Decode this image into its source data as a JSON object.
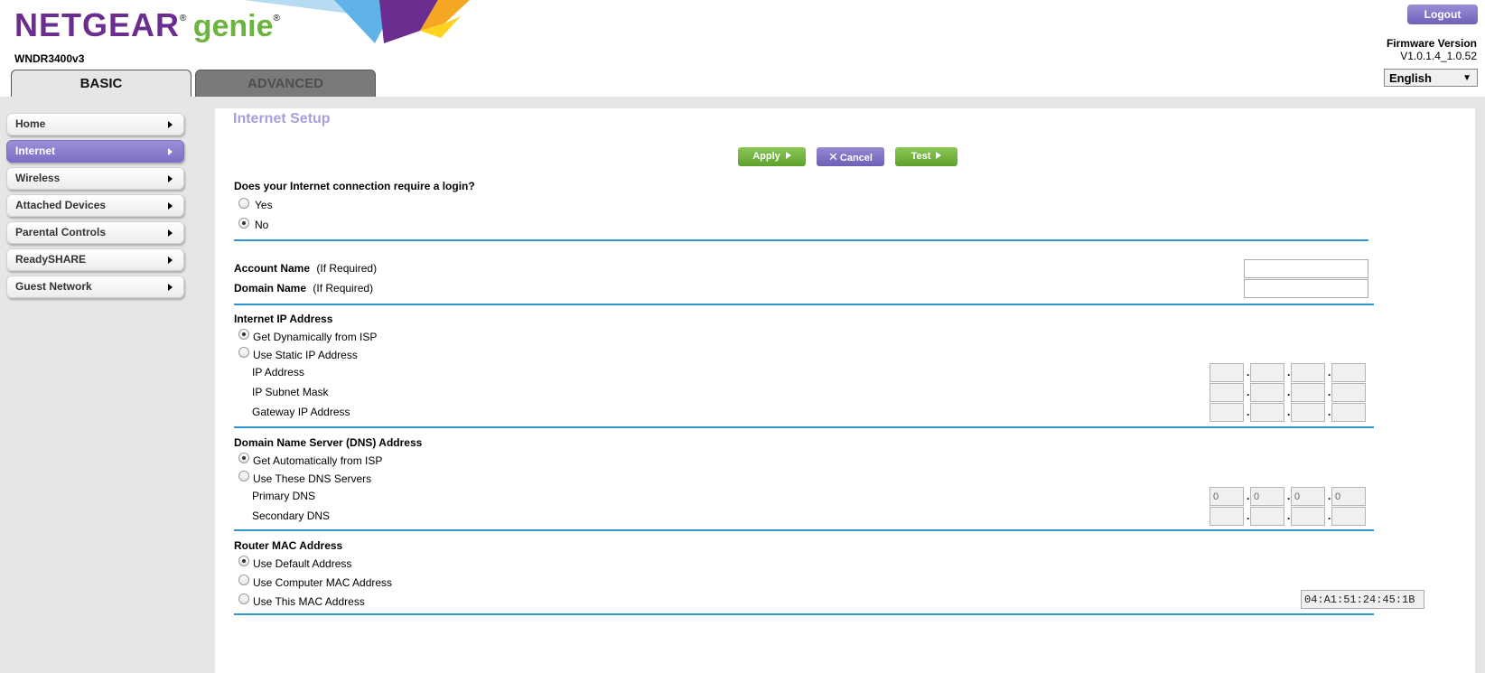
{
  "header": {
    "brand": "NETGEAR",
    "brand_mark": "®",
    "product": "genie",
    "product_mark": "®",
    "model": "WNDR3400v3",
    "logout_label": "Logout",
    "firmware_label": "Firmware Version",
    "firmware_value": "V1.0.1.4_1.0.52",
    "language": "English"
  },
  "tabs": [
    {
      "label": "BASIC",
      "active": true
    },
    {
      "label": "ADVANCED",
      "active": false
    }
  ],
  "sidebar": {
    "items": [
      {
        "label": "Home",
        "active": false
      },
      {
        "label": "Internet",
        "active": true
      },
      {
        "label": "Wireless",
        "active": false
      },
      {
        "label": "Attached Devices",
        "active": false
      },
      {
        "label": "Parental Controls",
        "active": false
      },
      {
        "label": "ReadySHARE",
        "active": false
      },
      {
        "label": "Guest Network",
        "active": false
      }
    ]
  },
  "main": {
    "title": "Internet Setup",
    "buttons": {
      "apply": "Apply",
      "cancel": "Cancel",
      "test": "Test"
    },
    "login": {
      "question": "Does your Internet connection require a login?",
      "yes": "Yes",
      "no": "No",
      "selected": "No"
    },
    "account": {
      "account_name_label": "Account Name",
      "account_name_hint": "(If Required)",
      "account_name_value": "",
      "domain_name_label": "Domain Name",
      "domain_name_hint": "(If Required)",
      "domain_name_value": ""
    },
    "internet_ip": {
      "heading": "Internet IP Address",
      "option_dynamic": "Get Dynamically from ISP",
      "option_static": "Use Static IP Address",
      "selected": "Get Dynamically from ISP",
      "ip_label": "IP Address",
      "subnet_label": "IP Subnet Mask",
      "gateway_label": "Gateway IP Address",
      "ip_value": [
        "",
        "",
        "",
        ""
      ],
      "subnet_value": [
        "",
        "",
        "",
        ""
      ],
      "gateway_value": [
        "",
        "",
        "",
        ""
      ]
    },
    "dns": {
      "heading": "Domain Name Server (DNS) Address",
      "option_auto": "Get Automatically from ISP",
      "option_manual": "Use These DNS Servers",
      "selected": "Get Automatically from ISP",
      "primary_label": "Primary DNS",
      "secondary_label": "Secondary DNS",
      "primary_value": [
        "0",
        "0",
        "0",
        "0"
      ],
      "secondary_value": [
        "",
        "",
        "",
        ""
      ]
    },
    "mac": {
      "heading": "Router MAC Address",
      "option_default": "Use Default Address",
      "option_computer": "Use Computer MAC Address",
      "option_this": "Use This MAC Address",
      "selected": "Use Default Address",
      "value": "04:A1:51:24:45:1B"
    }
  },
  "colors": {
    "accent_purple": "#7d6fc6",
    "brand_purple": "#6b2d8f",
    "genie_green": "#6cb33f",
    "button_green": "#6aad36",
    "separator_blue": "#2f96cf",
    "title_lavender": "#a99edb"
  }
}
